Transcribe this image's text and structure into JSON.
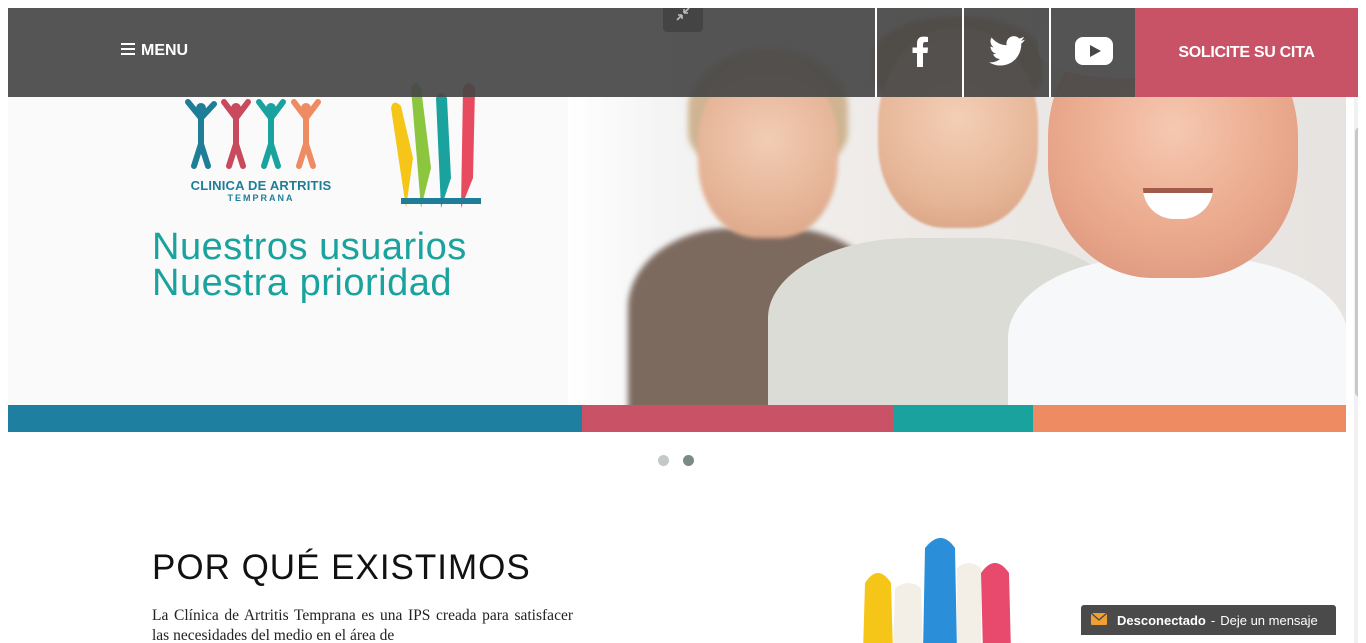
{
  "header": {
    "menu_label": "MENU",
    "cta_label": "SOLICITE SU CITA",
    "social": [
      {
        "name": "facebook",
        "icon": "facebook-icon"
      },
      {
        "name": "twitter",
        "icon": "twitter-icon"
      },
      {
        "name": "youtube",
        "icon": "youtube-icon"
      }
    ]
  },
  "hero": {
    "logo_name": "CLINICA DE ARTRITIS",
    "logo_sub": "TEMPRANA",
    "tagline_line1": "Nuestros usuarios",
    "tagline_line2": "Nuestra prioridad",
    "strip_colors": [
      "#1f7fa1",
      "#c95266",
      "#1aa39e",
      "#ef8b63"
    ],
    "slider_dots": 2,
    "active_dot": 2
  },
  "about": {
    "title": "POR QUÉ EXISTIMOS",
    "text": "La Clínica de Artritis Temprana es una IPS creada para satisfacer las necesidades del medio en el área de"
  },
  "chat": {
    "status": "Desconectado",
    "separator": "-",
    "message": "Deje un mensaje",
    "icon": "envelope-icon"
  },
  "colors": {
    "topbar": "#464746",
    "cta": "#c85266",
    "tagline": "#1aa39e"
  }
}
